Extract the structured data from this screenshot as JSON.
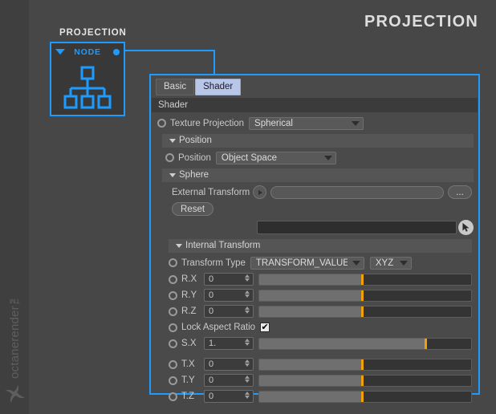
{
  "page": {
    "title": "PROJECTION",
    "watermark_text": "octanerender™",
    "watermark_logo": "octane-swirl-logo"
  },
  "node_graph": {
    "group_label": "PROJECTION",
    "node": {
      "title": "NODE",
      "collapse_icon": "triangle-down-icon",
      "output_port": "node-output-port",
      "glyph": "hierarchy-icon"
    }
  },
  "panel": {
    "tabs": [
      {
        "label": "Basic",
        "active": false
      },
      {
        "label": "Shader",
        "active": true
      }
    ],
    "section_title": "Shader",
    "texture_projection": {
      "label": "Texture Projection",
      "value": "Spherical"
    },
    "position_group": {
      "header": "Position",
      "position": {
        "label": "Position",
        "value": "Object Space"
      }
    },
    "sphere_group": {
      "header": "Sphere",
      "external_transform": {
        "label": "External Transform",
        "value": "",
        "browse_label": "..."
      },
      "reset_label": "Reset",
      "link_field_value": ""
    },
    "internal_transform": {
      "header": "Internal Transform",
      "transform_type": {
        "label": "Transform Type",
        "value": "TRANSFORM_VALUE",
        "order_value": "XYZ"
      },
      "rotation": [
        {
          "label": "R.X",
          "value": "0",
          "slider_pct": 48
        },
        {
          "label": "R.Y",
          "value": "0",
          "slider_pct": 48
        },
        {
          "label": "R.Z",
          "value": "0",
          "slider_pct": 48
        }
      ],
      "lock_aspect_ratio": {
        "label": "Lock Aspect Ratio",
        "checked": true,
        "check_glyph": "✔"
      },
      "scale": [
        {
          "label": "S.X",
          "value": "1.",
          "slider_pct": 78
        }
      ],
      "translation": [
        {
          "label": "T.X",
          "value": "0",
          "slider_pct": 48
        },
        {
          "label": "T.Y",
          "value": "0",
          "slider_pct": 48
        },
        {
          "label": "T.Z",
          "value": "0",
          "slider_pct": 48
        }
      ]
    }
  },
  "colors": {
    "accent_blue": "#1e9bff",
    "slider_knob": "#f2a007",
    "background": "#474747",
    "panel_background": "#4a4a4a"
  }
}
